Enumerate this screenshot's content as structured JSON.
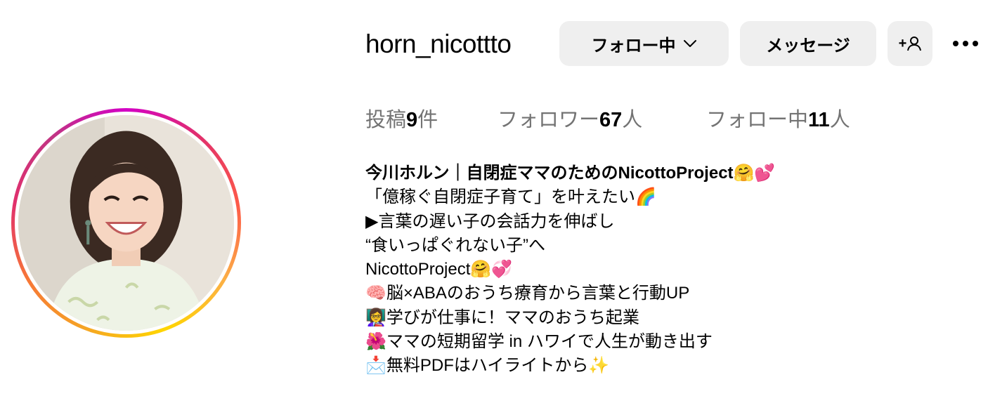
{
  "profile": {
    "username": "horn_nicottto"
  },
  "actions": {
    "follow_label": "フォロー中",
    "message_label": "メッセージ",
    "adduser_label": "+"
  },
  "stats": {
    "posts_label": "投稿",
    "posts_count": "9",
    "posts_unit": "件",
    "followers_label": "フォロワー",
    "followers_count": "67",
    "followers_unit": "人",
    "following_label": "フォロー中",
    "following_count": "11",
    "following_unit": "人"
  },
  "bio": {
    "name": "今川ホルン｜自閉症ママのためのNicottoProject🤗💕",
    "lines": [
      "「億稼ぐ自閉症子育て」を叶えたい🌈",
      "▶言葉の遅い子の会話力を伸ばし",
      "“食いっぱぐれない子”へ",
      "NicottoProject🤗💞",
      "🧠脳×ABAのおうち療育から言葉と行動UP",
      "👩‍🏫学びが仕事に！ママのおうち起業",
      "🌺ママの短期留学 in ハワイで人生が動き出す",
      "📩無料PDFはハイライトから✨"
    ]
  },
  "icons": {
    "chevron": "chevron-down-icon",
    "adduser": "add-user-icon",
    "more": "more-icon"
  }
}
